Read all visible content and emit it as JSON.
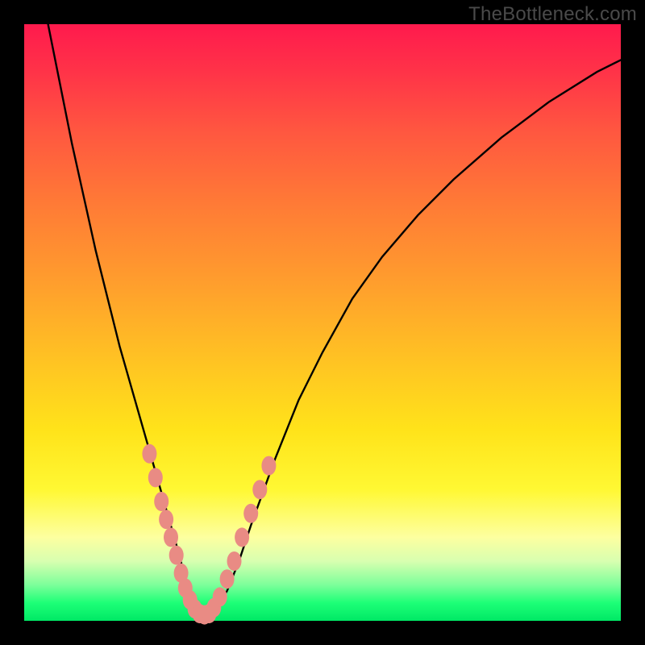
{
  "watermark": "TheBottleneck.com",
  "chart_data": {
    "type": "line",
    "title": "",
    "xlabel": "",
    "ylabel": "",
    "xlim": [
      0,
      100
    ],
    "ylim": [
      0,
      100
    ],
    "series": [
      {
        "name": "bottleneck-curve",
        "x": [
          4,
          6,
          8,
          10,
          12,
          14,
          16,
          18,
          20,
          22,
          24,
          26,
          27,
          28,
          29,
          30,
          31,
          32,
          34,
          36,
          38,
          42,
          46,
          50,
          55,
          60,
          66,
          72,
          80,
          88,
          96,
          100
        ],
        "y": [
          100,
          90,
          80,
          71,
          62,
          54,
          46,
          39,
          32,
          25,
          18,
          11,
          7,
          4,
          2,
          1,
          1,
          2,
          5,
          10,
          16,
          27,
          37,
          45,
          54,
          61,
          68,
          74,
          81,
          87,
          92,
          94
        ]
      }
    ],
    "markers": {
      "name": "highlighted-points",
      "color": "#e98b84",
      "points": [
        {
          "x": 21.0,
          "y": 28
        },
        {
          "x": 22.0,
          "y": 24
        },
        {
          "x": 23.0,
          "y": 20
        },
        {
          "x": 23.8,
          "y": 17
        },
        {
          "x": 24.6,
          "y": 14
        },
        {
          "x": 25.5,
          "y": 11
        },
        {
          "x": 26.3,
          "y": 8
        },
        {
          "x": 27.0,
          "y": 5.5
        },
        {
          "x": 27.8,
          "y": 3.5
        },
        {
          "x": 28.6,
          "y": 2
        },
        {
          "x": 29.4,
          "y": 1.2
        },
        {
          "x": 30.2,
          "y": 1
        },
        {
          "x": 31.0,
          "y": 1.2
        },
        {
          "x": 31.8,
          "y": 2.2
        },
        {
          "x": 32.8,
          "y": 4
        },
        {
          "x": 34.0,
          "y": 7
        },
        {
          "x": 35.2,
          "y": 10
        },
        {
          "x": 36.5,
          "y": 14
        },
        {
          "x": 38.0,
          "y": 18
        },
        {
          "x": 39.5,
          "y": 22
        },
        {
          "x": 41.0,
          "y": 26
        }
      ]
    }
  }
}
